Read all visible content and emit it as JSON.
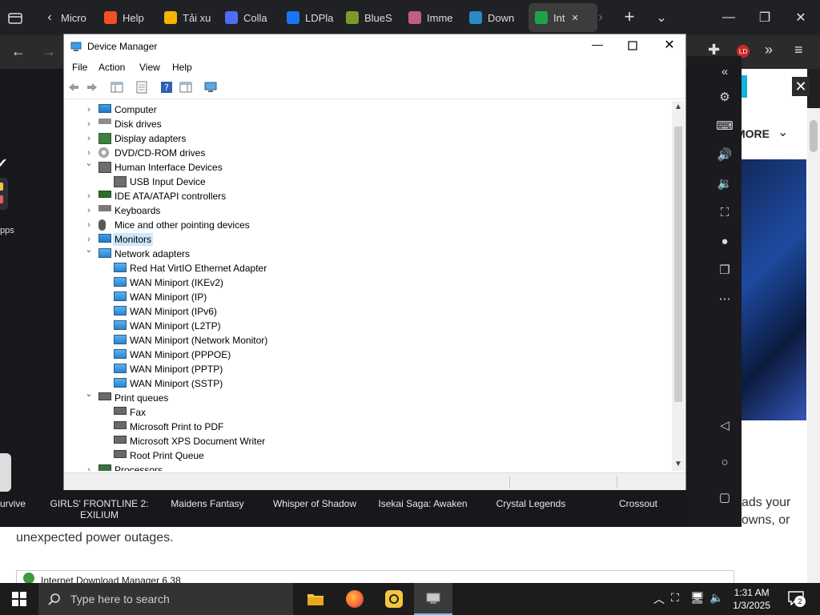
{
  "browser": {
    "tabs": [
      {
        "label": "Micro",
        "color": "#1e6fd9"
      },
      {
        "label": "Help",
        "color": "#f25022"
      },
      {
        "label": "Tải xu",
        "color": "#f4b400"
      },
      {
        "label": "Colla",
        "color": "#4c6ef5"
      },
      {
        "label": "LDPla",
        "color": "#1877f2"
      },
      {
        "label": "BlueS",
        "color": "#7a9a2a"
      },
      {
        "label": "Imme",
        "color": "#c06080"
      },
      {
        "label": "Down",
        "color": "#2a8ac4"
      },
      {
        "label": "Int",
        "color": "#1fa34a"
      }
    ],
    "more_button": "MORE",
    "page_text_right_1": "ads your",
    "page_text_right_2": "owns, or",
    "page_text_bottom": "unexpected power outages.",
    "bottom_window_title": "Internet Download Manager 6.38"
  },
  "partial_left": {
    "apps_label": "pps",
    "survive_label": "urvive"
  },
  "games": [
    {
      "label": "GIRLS' FRONTLINE 2:\nEXILIUM"
    },
    {
      "label": "Maidens Fantasy"
    },
    {
      "label": "Whisper of Shadow"
    },
    {
      "label": "Isekai Saga: Awaken"
    },
    {
      "label": "Crystal Legends"
    },
    {
      "label": "Crossout"
    }
  ],
  "device_manager": {
    "title": "Device Manager",
    "menu": [
      "File",
      "Action",
      "View",
      "Help"
    ],
    "tree": [
      {
        "label": "Computer",
        "level": 0,
        "state": "collapsed",
        "icon": "computer-icon"
      },
      {
        "label": "Disk drives",
        "level": 0,
        "state": "collapsed",
        "icon": "disk-drive-icon"
      },
      {
        "label": "Display adapters",
        "level": 0,
        "state": "collapsed",
        "icon": "display-adapter-icon"
      },
      {
        "label": "DVD/CD-ROM drives",
        "level": 0,
        "state": "collapsed",
        "icon": "cdrom-icon"
      },
      {
        "label": "Human Interface Devices",
        "level": 0,
        "state": "expanded",
        "icon": "hid-icon"
      },
      {
        "label": "USB Input Device",
        "level": 1,
        "state": "leaf",
        "icon": "hid-icon"
      },
      {
        "label": "IDE ATA/ATAPI controllers",
        "level": 0,
        "state": "collapsed",
        "icon": "ide-controller-icon"
      },
      {
        "label": "Keyboards",
        "level": 0,
        "state": "collapsed",
        "icon": "keyboard-icon"
      },
      {
        "label": "Mice and other pointing devices",
        "level": 0,
        "state": "collapsed",
        "icon": "mouse-icon"
      },
      {
        "label": "Monitors",
        "level": 0,
        "state": "collapsed",
        "icon": "monitor-icon",
        "selected": true
      },
      {
        "label": "Network adapters",
        "level": 0,
        "state": "expanded",
        "icon": "network-adapter-icon"
      },
      {
        "label": "Red Hat VirtIO Ethernet Adapter",
        "level": 1,
        "state": "leaf",
        "icon": "network-adapter-icon"
      },
      {
        "label": "WAN Miniport (IKEv2)",
        "level": 1,
        "state": "leaf",
        "icon": "network-adapter-icon"
      },
      {
        "label": "WAN Miniport (IP)",
        "level": 1,
        "state": "leaf",
        "icon": "network-adapter-icon"
      },
      {
        "label": "WAN Miniport (IPv6)",
        "level": 1,
        "state": "leaf",
        "icon": "network-adapter-icon"
      },
      {
        "label": "WAN Miniport (L2TP)",
        "level": 1,
        "state": "leaf",
        "icon": "network-adapter-icon"
      },
      {
        "label": "WAN Miniport (Network Monitor)",
        "level": 1,
        "state": "leaf",
        "icon": "network-adapter-icon"
      },
      {
        "label": "WAN Miniport (PPPOE)",
        "level": 1,
        "state": "leaf",
        "icon": "network-adapter-icon"
      },
      {
        "label": "WAN Miniport (PPTP)",
        "level": 1,
        "state": "leaf",
        "icon": "network-adapter-icon"
      },
      {
        "label": "WAN Miniport (SSTP)",
        "level": 1,
        "state": "leaf",
        "icon": "network-adapter-icon"
      },
      {
        "label": "Print queues",
        "level": 0,
        "state": "expanded",
        "icon": "printer-icon"
      },
      {
        "label": "Fax",
        "level": 1,
        "state": "leaf",
        "icon": "printer-icon"
      },
      {
        "label": "Microsoft Print to PDF",
        "level": 1,
        "state": "leaf",
        "icon": "printer-icon"
      },
      {
        "label": "Microsoft XPS Document Writer",
        "level": 1,
        "state": "leaf",
        "icon": "printer-icon"
      },
      {
        "label": "Root Print Queue",
        "level": 1,
        "state": "leaf",
        "icon": "printer-icon"
      },
      {
        "label": "Processors",
        "level": 0,
        "state": "collapsed",
        "icon": "processor-icon"
      }
    ]
  },
  "taskbar": {
    "search_placeholder": "Type here to search",
    "time": "1:31 AM",
    "date": "1/3/2025",
    "notification_count": "2"
  },
  "colors": {
    "selection": "#cce8ff",
    "taskbar": "#1c1c1c",
    "accent": "#76b9ed"
  }
}
